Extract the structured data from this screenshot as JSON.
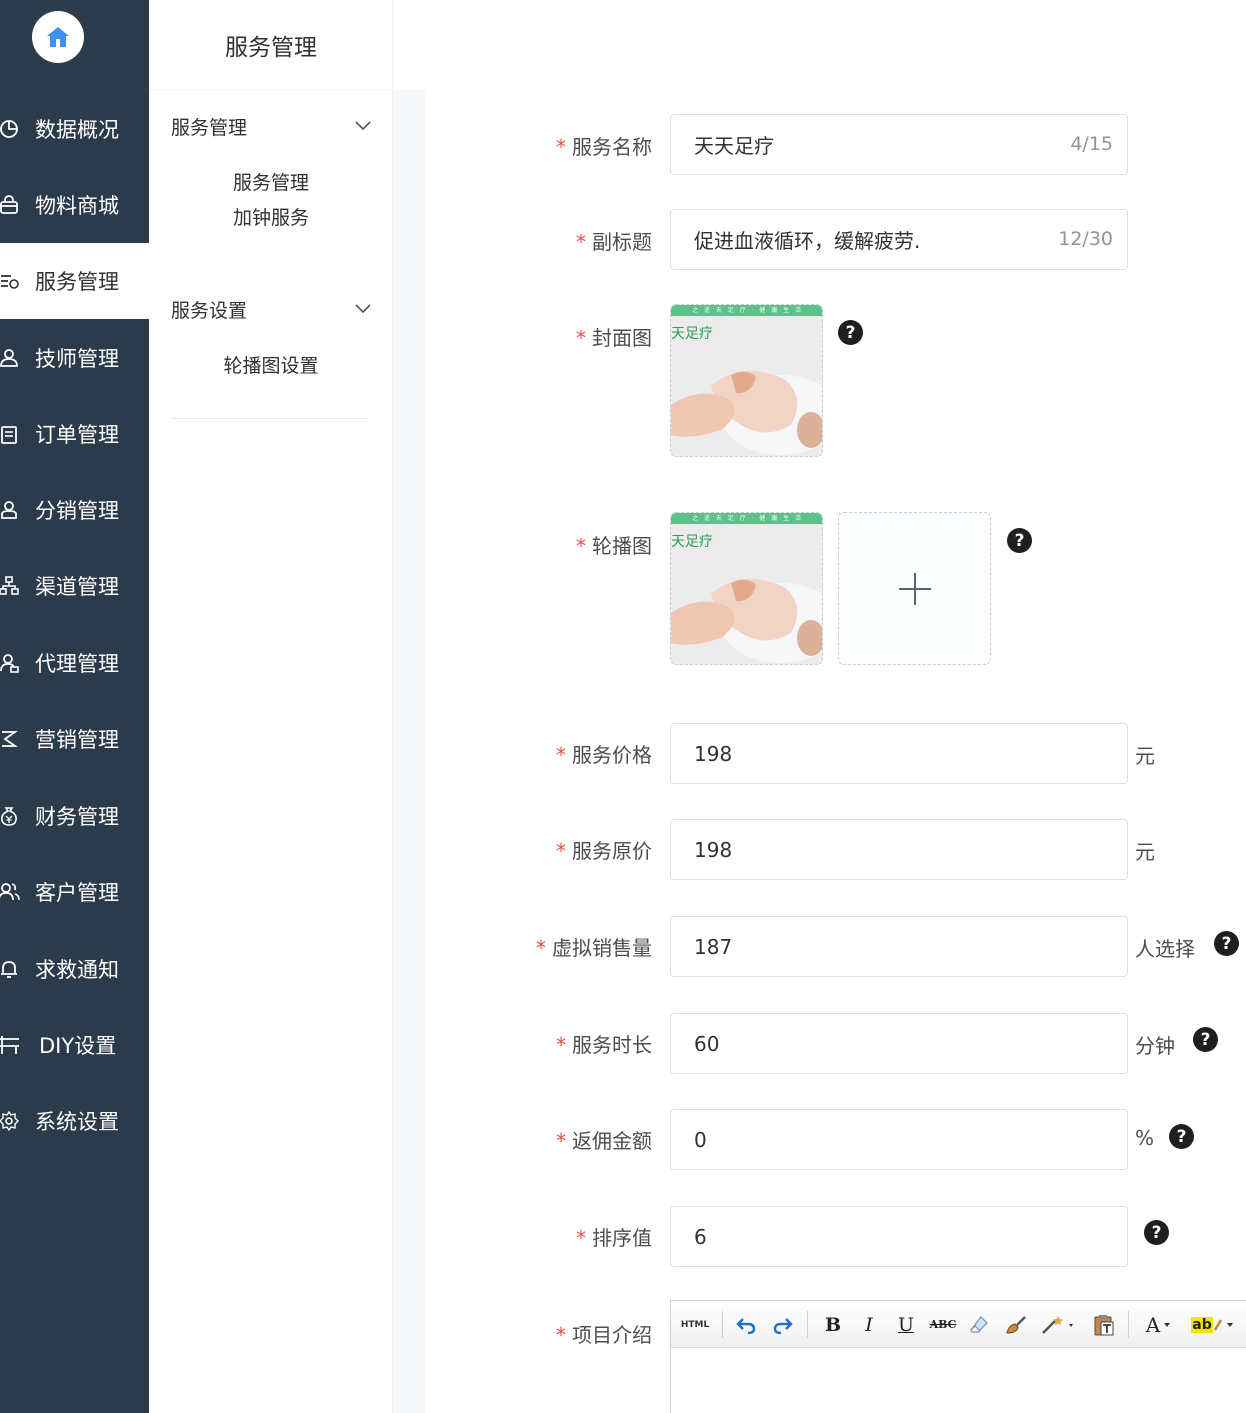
{
  "sidebar": {
    "items": [
      {
        "label": "数据概况",
        "icon": "pie-chart-icon"
      },
      {
        "label": "物料商城",
        "icon": "shopping-bag-icon"
      },
      {
        "label": "服务管理",
        "icon": "service-list-icon",
        "active": true
      },
      {
        "label": "技师管理",
        "icon": "user-badge-icon"
      },
      {
        "label": "订单管理",
        "icon": "order-clipboard-icon"
      },
      {
        "label": "分销管理",
        "icon": "distribution-user-icon"
      },
      {
        "label": "渠道管理",
        "icon": "channel-sitemap-icon"
      },
      {
        "label": "代理管理",
        "icon": "agent-users-icon"
      },
      {
        "label": "营销管理",
        "icon": "marketing-icon"
      },
      {
        "label": "财务管理",
        "icon": "money-bag-icon"
      },
      {
        "label": "客户管理",
        "icon": "customers-icon"
      },
      {
        "label": "求救通知",
        "icon": "bell-icon"
      },
      {
        "label": "DIY设置",
        "icon": "diy-layout-icon"
      },
      {
        "label": "系统设置",
        "icon": "gear-icon"
      }
    ]
  },
  "submenu": {
    "title": "服务管理",
    "groups": [
      {
        "label": "服务管理",
        "items": [
          "服务管理",
          "加钟服务"
        ]
      },
      {
        "label": "服务设置",
        "items": [
          "轮播图设置"
        ]
      }
    ]
  },
  "form": {
    "name": {
      "label": "服务名称",
      "value": "天天足疗",
      "counter": "4/15"
    },
    "subtitle": {
      "label": "副标题",
      "value": "促进血液循环，缓解疲劳.",
      "counter": "12/30"
    },
    "cover": {
      "label": "封面图"
    },
    "carousel": {
      "label": "轮播图"
    },
    "image": {
      "brand": "天足疗",
      "banner": "之 道 天 足 疗 · 健 康 生 活"
    },
    "price": {
      "label": "服务价格",
      "value": "198",
      "unit": "元"
    },
    "original_price": {
      "label": "服务原价",
      "value": "198",
      "unit": "元"
    },
    "virtual_sales": {
      "label": "虚拟销售量",
      "value": "187",
      "unit": "人选择"
    },
    "duration": {
      "label": "服务时长",
      "value": "60",
      "unit": "分钟"
    },
    "commission": {
      "label": "返佣金额",
      "value": "0",
      "unit": "%"
    },
    "sort": {
      "label": "排序值",
      "value": "6"
    },
    "intro": {
      "label": "项目介绍"
    },
    "required_mark": "*",
    "help_glyph": "?"
  },
  "editor": {
    "html_label": "HTML",
    "bold": "B",
    "italic": "I",
    "underline": "U",
    "strike": "ABC",
    "font_color": "A",
    "highlight": "ab"
  },
  "colors": {
    "sidebar_bg": "#2c3b4b",
    "accent": "#409eff",
    "required": "#e8503e"
  }
}
